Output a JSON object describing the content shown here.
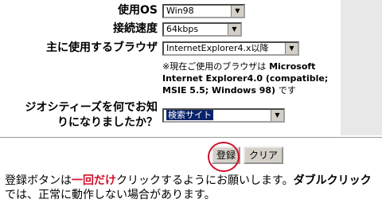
{
  "form": {
    "os": {
      "label": "使用OS",
      "value": "Win98"
    },
    "speed": {
      "label": "接続速度",
      "value": "64kbps"
    },
    "browser": {
      "label": "主に使用するブラウザ",
      "value": "InternetExplorer4.x以降",
      "note_prefix": "※現在ご使用のブラウザは",
      "note_browser": "Microsoft Internet Explorer4.0 (compatible; MSIE 5.5; Windows 98)",
      "note_suffix": "です"
    },
    "referral": {
      "label_line1": "ジオシティーズを何でお知",
      "label_line2": "りになりましたか？",
      "value": "検索サイト"
    }
  },
  "buttons": {
    "register": "登録",
    "clear": "クリア"
  },
  "footer": {
    "part1": "登録ボタンは",
    "emphasis_red": "一回だけ",
    "part2": "クリックするようにお願いします。",
    "emphasis_bold": "ダブルクリック",
    "part3": "では、正常に動作しない場合があります。"
  },
  "colors": {
    "highlight_select": "#0a246a",
    "circle_annotation": "#d0102a",
    "emphasis_red": "#d0102a"
  }
}
